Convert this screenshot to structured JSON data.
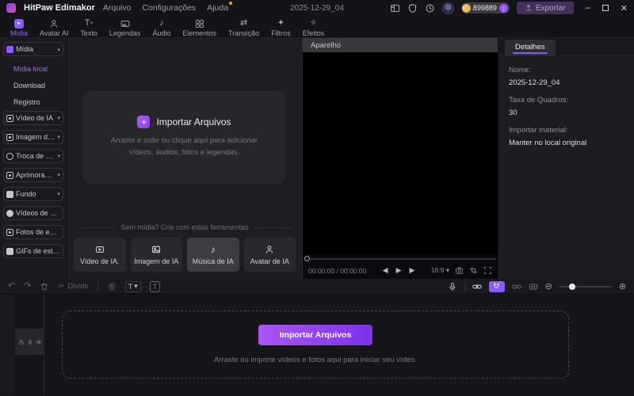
{
  "colors": {
    "accent": "#8b5cf6",
    "accent_light": "#a06af8",
    "coin": "#e0a93f",
    "import_gradient_start": "#a957f2",
    "import_gradient_end": "#7d32e9"
  },
  "titlebar": {
    "app_name": "HitPaw Edimakor",
    "menus": [
      "Arquivo",
      "Configurações",
      "Ajuda"
    ],
    "document_title": "2025-12-29_04",
    "credits": "899889",
    "export_label": "Exportar"
  },
  "ribbon": {
    "tabs": [
      {
        "label": "Mídia"
      },
      {
        "label": "Avatar AI"
      },
      {
        "label": "Texto"
      },
      {
        "label": "Legendas"
      },
      {
        "label": "Áudio"
      },
      {
        "label": "Elementos"
      },
      {
        "label": "Transição"
      },
      {
        "label": "Filtros"
      },
      {
        "label": "Efeitos"
      }
    ]
  },
  "sidebar": {
    "media_group": "Mídia",
    "sub_items": [
      "Mídia local",
      "Download",
      "Registro"
    ],
    "groups": [
      "Vídeo de IA",
      "Imagem de IA",
      "Troca de Rost...",
      "Aprimorador ...",
      "Fundo",
      "Vídeos de esto...",
      "Fotos de estoque",
      "GIFs de estoque"
    ]
  },
  "media_panel": {
    "import_title": "Importar Arquivos",
    "import_hint_line1": "Arraste e solte ou clique aqui para adicionar",
    "import_hint_line2": "vídeos, áudios, fotos e legendas.",
    "tools_divider": "Sem mídia? Crie com estas ferramentas",
    "tools": [
      "Vídeo de IA.",
      "Imagem de IA",
      "Música de IA",
      "Avatar de IA"
    ]
  },
  "preview": {
    "header": "Aparelho",
    "time_display": "00:00:00 / 00:00:00",
    "aspect_ratio": "16:9"
  },
  "details": {
    "tab_label": "Detalhes",
    "fields": [
      {
        "label": "Nome:",
        "value": "2025-12-29_04"
      },
      {
        "label": "Taxa de Quadros:",
        "value": "30"
      },
      {
        "label": "Importar material:",
        "value": "Manter no local original"
      }
    ]
  },
  "timeline_toolbar": {
    "split_label": "Dividir"
  },
  "timeline": {
    "import_button": "Importar Arquivos",
    "import_hint": "Arraste ou importe vídeos e fotos aqui para iniciar seu vídeo."
  },
  "icons": {
    "caret_down": "▾",
    "caret_up": "▴",
    "note": "♪",
    "scissors": "✂",
    "undo": "↶",
    "redo": "↷",
    "play": "▶",
    "prev": "◀",
    "next": "▶",
    "zoom_out": "⊖",
    "zoom_in": "⊕",
    "minimize": "–",
    "close": "✕",
    "plus": "+",
    "transition": "⇄",
    "sparkle": "✦",
    "sparkle_outline": "✧",
    "text_tool": "T",
    "boost_up": "↑",
    "media_play": "▸"
  }
}
